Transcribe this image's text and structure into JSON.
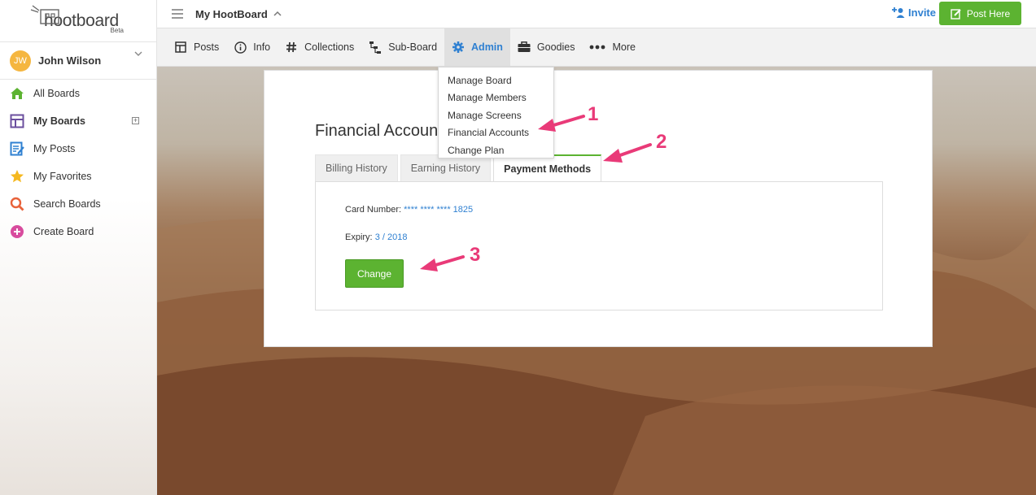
{
  "brand": {
    "name": "hootboard",
    "tag": "Beta"
  },
  "user": {
    "initials": "JW",
    "name": "John Wilson"
  },
  "sidebar": {
    "items": [
      {
        "label": "All Boards",
        "icon": "home-icon"
      },
      {
        "label": "My Boards",
        "icon": "boards-icon",
        "active": true
      },
      {
        "label": "My Posts",
        "icon": "posts-icon"
      },
      {
        "label": "My Favorites",
        "icon": "star-icon"
      },
      {
        "label": "Search Boards",
        "icon": "search-icon"
      },
      {
        "label": "Create Board",
        "icon": "plus-circle-icon"
      }
    ]
  },
  "header": {
    "board_title": "My HootBoard",
    "invite_label": "Invite",
    "post_here_label": "Post Here"
  },
  "tabs": [
    {
      "label": "Posts",
      "icon": "grid-icon"
    },
    {
      "label": "Info",
      "icon": "info-icon"
    },
    {
      "label": "Collections",
      "icon": "hash-icon"
    },
    {
      "label": "Sub-Board",
      "icon": "tree-icon"
    },
    {
      "label": "Admin",
      "icon": "gear-icon",
      "active": true
    },
    {
      "label": "Goodies",
      "icon": "briefcase-icon"
    },
    {
      "label": "More",
      "icon": "dots-icon"
    }
  ],
  "admin_menu": [
    "Manage Board",
    "Manage Members",
    "Manage Screens",
    "Financial Accounts",
    "Change Plan"
  ],
  "card": {
    "title": "Financial Accounts",
    "tabs": [
      "Billing History",
      "Earning History",
      "Payment Methods"
    ],
    "active_tab": "Payment Methods",
    "card_number_label": "Card Number:",
    "card_number_value": "**** **** **** 1825",
    "expiry_label": "Expiry:",
    "expiry_value": "3 / 2018",
    "change_label": "Change"
  },
  "annotations": [
    "1",
    "2",
    "3"
  ],
  "colors": {
    "accent": "#2f80d1",
    "green": "#5cb331",
    "annotation": "#e93a78"
  }
}
